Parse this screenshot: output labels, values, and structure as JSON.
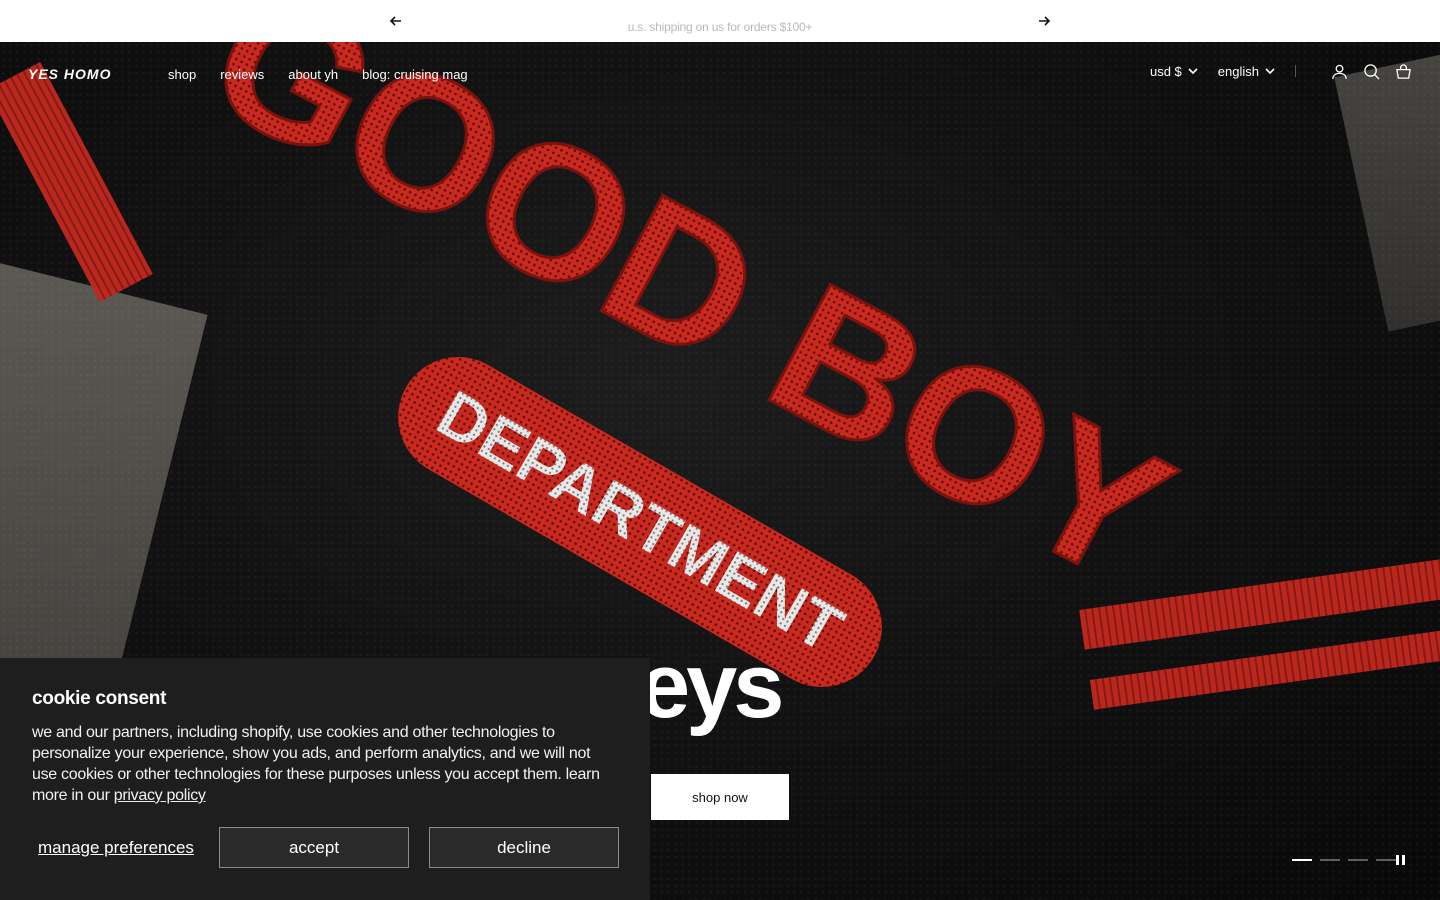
{
  "announcement": {
    "message": "u.s. shipping on us for orders $100+",
    "prev_icon": "arrow-left-icon",
    "next_icon": "arrow-right-icon"
  },
  "header": {
    "logo": "YES HOMO",
    "nav": [
      "shop",
      "reviews",
      "about yh",
      "blog: cruising mag"
    ],
    "currency": "usd $",
    "language": "english",
    "icons": [
      "account-icon",
      "search-icon",
      "cart-icon"
    ]
  },
  "hero": {
    "graphic_text_top": "GOOD BOY",
    "graphic_text_patch": "DEPARTMENT",
    "headline": "rseys",
    "cta": "shop now",
    "slides": {
      "count": 4,
      "active": 1
    },
    "pause_icon": "pause-icon"
  },
  "cookie": {
    "title": "cookie consent",
    "body": "we and our partners, including shopify, use cookies and other technologies to personalize your experience, show you ads, and perform analytics, and we will not use cookies or other technologies for these purposes unless you accept them. learn more in our ",
    "link": "privacy policy",
    "manage": "manage preferences",
    "accept": "accept",
    "decline": "decline"
  },
  "colors": {
    "accent_red": "#c2281f",
    "banner_bg": "#1e1e1e",
    "announce_text": "#b9b9b9"
  }
}
